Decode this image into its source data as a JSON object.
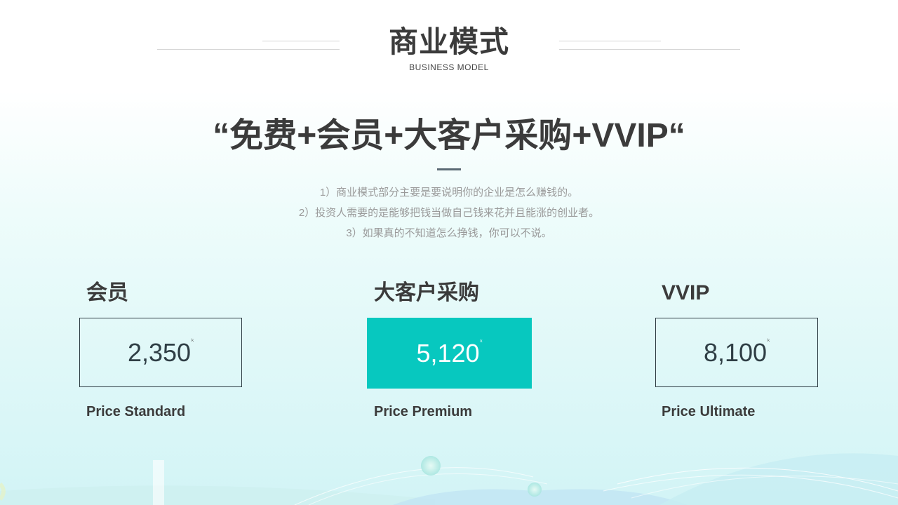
{
  "header": {
    "title": "商业模式",
    "subtitle": "BUSINESS  MODEL"
  },
  "headline": "“免费+会员+大客户采购+VVIP“",
  "description": [
    "1）商业模式部分主要是要说明你的企业是怎么赚钱的。",
    "2）投资人需要的是能够把钱当做自己钱来花并且能涨的创业者。",
    "3）如果真的不知道怎么挣钱，你可以不说。"
  ],
  "plans": [
    {
      "title": "会员",
      "price": "2,350",
      "unit": "k",
      "label": "Price Standard",
      "highlighted": false
    },
    {
      "title": "大客户采购",
      "price": "5,120",
      "unit": "k",
      "label": "Price Premium",
      "highlighted": true
    },
    {
      "title": "VVIP",
      "price": "8,100",
      "unit": "k",
      "label": "Price Ultimate",
      "highlighted": false
    }
  ],
  "colors": {
    "accent": "#07c8bf",
    "text": "#3b3b3b",
    "muted": "#9a9a9a",
    "border": "#2f3e45"
  }
}
